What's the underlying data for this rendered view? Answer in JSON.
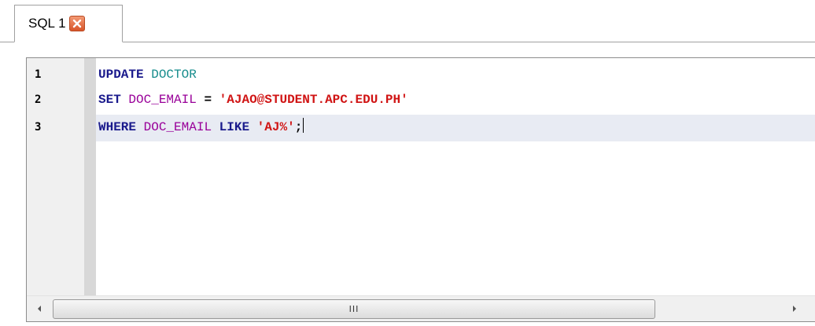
{
  "tabs": [
    {
      "label": "SQL 1",
      "close_icon": "close-icon"
    }
  ],
  "editor": {
    "line_numbers": [
      "1",
      "2",
      "3"
    ],
    "lines": [
      [
        {
          "text": "UPDATE",
          "kind": "kw"
        },
        {
          "text": " ",
          "kind": "op"
        },
        {
          "text": "DOCTOR",
          "kind": "ident-teal"
        }
      ],
      [
        {
          "text": "SET",
          "kind": "kw"
        },
        {
          "text": " ",
          "kind": "op"
        },
        {
          "text": "DOC_EMAIL",
          "kind": "ident"
        },
        {
          "text": " = ",
          "kind": "op"
        },
        {
          "text": "'AJAO@STUDENT.APC.EDU.PH'",
          "kind": "str"
        }
      ],
      [
        {
          "text": "WHERE",
          "kind": "kw"
        },
        {
          "text": " ",
          "kind": "op"
        },
        {
          "text": "DOC_EMAIL",
          "kind": "ident"
        },
        {
          "text": " ",
          "kind": "op"
        },
        {
          "text": "LIKE",
          "kind": "kw"
        },
        {
          "text": " ",
          "kind": "op"
        },
        {
          "text": "'AJ%'",
          "kind": "str"
        },
        {
          "text": ";",
          "kind": "op"
        }
      ]
    ],
    "current_line": 3
  },
  "scrollbar": {
    "left_icon": "scroll-left-arrow-icon",
    "right_icon": "scroll-right-arrow-icon",
    "grip_label": "III"
  },
  "colors": {
    "keyword": "#1a1a8c",
    "identifier": "#990099",
    "table_identifier": "#168c8c",
    "string": "#d01414",
    "current_line_bg": "#e8ebf3",
    "close_button": "#e0663a"
  }
}
